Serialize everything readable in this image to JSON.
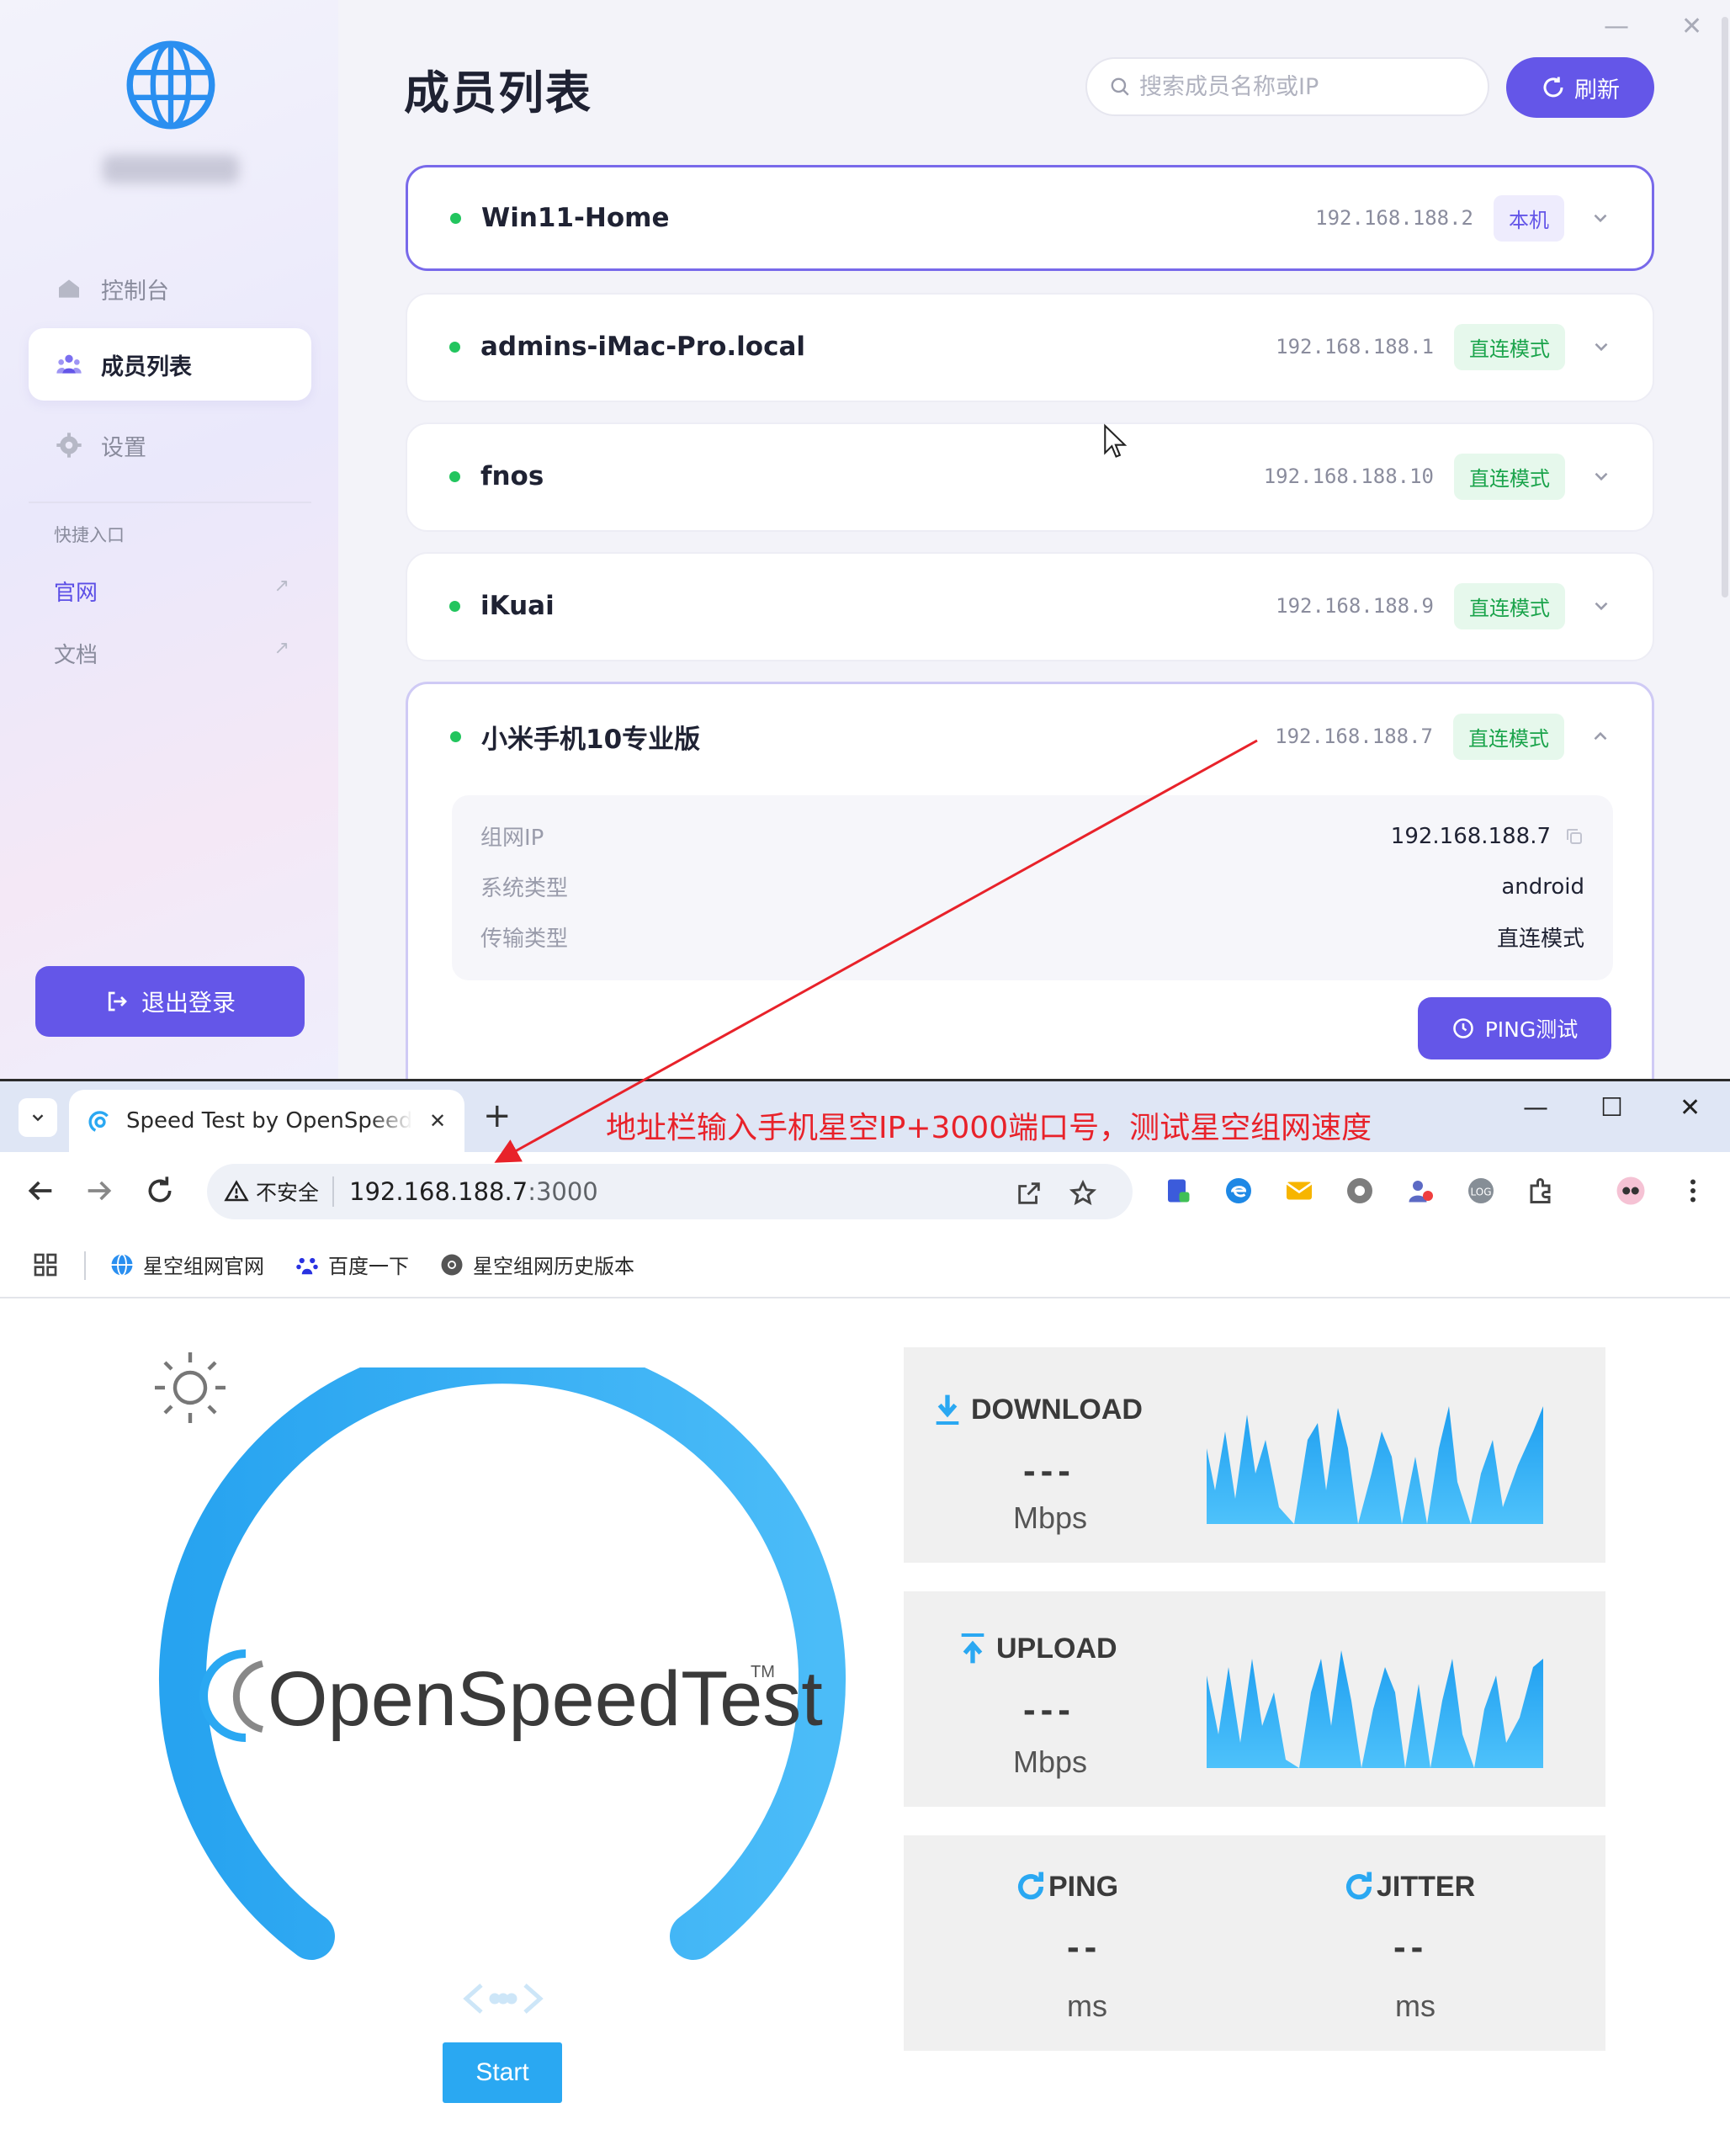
{
  "app": {
    "title": "成员列表",
    "username": "gdsl0883",
    "nav": [
      {
        "label": "控制台",
        "icon": "home-icon"
      },
      {
        "label": "成员列表",
        "icon": "users-icon",
        "active": true
      },
      {
        "label": "设置",
        "icon": "gear-icon"
      }
    ],
    "quick_title": "快捷入口",
    "quick_links": [
      {
        "label": "官网",
        "color": "#5b4ee6"
      },
      {
        "label": "文档",
        "color": "#8a8c9d"
      }
    ],
    "logout_label": "退出登录",
    "search_placeholder": "搜索成员名称或IP",
    "refresh_label": "刷新",
    "window_controls": {
      "minimize": "—",
      "close": "✕"
    },
    "members": [
      {
        "name": "Win11-Home",
        "ip": "192.168.188.2",
        "badge": "本机",
        "badge_type": "self",
        "state": "selected"
      },
      {
        "name": "admins-iMac-Pro.local",
        "ip": "192.168.188.1",
        "badge": "直连模式",
        "badge_type": "direct"
      },
      {
        "name": "fnos",
        "ip": "192.168.188.10",
        "badge": "直连模式",
        "badge_type": "direct"
      },
      {
        "name": "iKuai",
        "ip": "192.168.188.9",
        "badge": "直连模式",
        "badge_type": "direct"
      },
      {
        "name": "小米手机10专业版",
        "ip": "192.168.188.7",
        "badge": "直连模式",
        "badge_type": "direct",
        "state": "expanded"
      }
    ],
    "detail": {
      "rows": [
        {
          "label": "组网IP",
          "value": "192.168.188.7"
        },
        {
          "label": "系统类型",
          "value": "android"
        },
        {
          "label": "传输类型",
          "value": "直连模式"
        }
      ],
      "ping_label": "PING测试"
    }
  },
  "browser": {
    "tab_title": "Speed Test by OpenSpeedTest",
    "tab_close": "✕",
    "new_tab": "+",
    "annotation": "地址栏输入手机星空IP+3000端口号，测试星空组网速度",
    "security_label": "不安全",
    "url_host": "192.168.188.7",
    "url_port": ":3000",
    "window_controls": {
      "minimize": "—",
      "maximize": "☐",
      "close": "✕"
    },
    "bookmarks": [
      {
        "label": "星空组网官网",
        "icon": "globe-icon"
      },
      {
        "label": "百度一下",
        "icon": "baidu-paw-icon"
      },
      {
        "label": "星空组网历史版本",
        "icon": "chrome-icon"
      }
    ]
  },
  "speedtest": {
    "logo_text": "OpenSpeedTest",
    "logo_tm": "TM",
    "start_label": "Start",
    "download": {
      "label": "DOWNLOAD",
      "value": "---",
      "unit": "Mbps"
    },
    "upload": {
      "label": "UPLOAD",
      "value": "---",
      "unit": "Mbps"
    },
    "ping": {
      "label": "PING",
      "value": "--",
      "unit": "ms"
    },
    "jitter": {
      "label": "JITTER",
      "value": "--",
      "unit": "ms"
    },
    "colors": {
      "accent": "#2aa8f2",
      "brand_purple": "#6456e8",
      "annotation_red": "#e8222a"
    }
  }
}
